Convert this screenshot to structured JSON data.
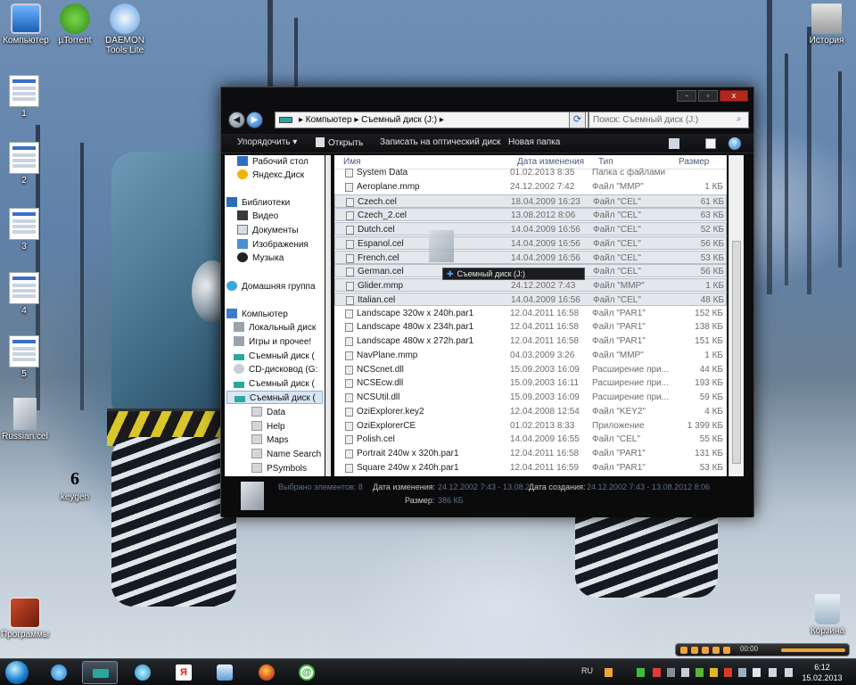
{
  "desktop": {
    "icons": [
      {
        "label": "Компьютер",
        "icon": "computer-icon"
      },
      {
        "label": "µTorrent",
        "icon": "utorrent-icon"
      },
      {
        "label": "DAEMON Tools Lite",
        "icon": "daemon-tools-icon"
      },
      {
        "label": "История",
        "icon": "history-icon"
      },
      {
        "label": "1",
        "icon": "window-thumbnail"
      },
      {
        "label": "2",
        "icon": "window-thumbnail"
      },
      {
        "label": "3",
        "icon": "window-thumbnail"
      },
      {
        "label": "4",
        "icon": "window-thumbnail"
      },
      {
        "label": "5",
        "icon": "window-thumbnail"
      },
      {
        "label": "Russian.cel",
        "icon": "file-icon"
      },
      {
        "label": "keygen",
        "icon": "keygen-icon"
      },
      {
        "label": "Программы",
        "icon": "programs-icon"
      },
      {
        "label": "Корзина",
        "icon": "recycle-bin-icon"
      }
    ],
    "keygen_glyph": "6"
  },
  "explorer": {
    "controls": {
      "minimize": "-",
      "maximize": "▫",
      "close": "x"
    },
    "address": {
      "path": "▸ Компьютер ▸ Съемный диск (J:) ▸",
      "dropdown": "▾"
    },
    "search_placeholder": "Поиск: Съемный диск (J:)",
    "toolbar": {
      "organize": "Упорядочить ▾",
      "open": "Открыть",
      "burn": "Записать на оптический диск",
      "new_folder": "Новая папка"
    },
    "nav": [
      {
        "label": "Рабочий стол",
        "icon": "desktop-icon"
      },
      {
        "label": "Яндекс.Диск",
        "icon": "yandex-disk-icon"
      },
      {
        "label": "Библиотеки",
        "icon": "libraries-icon"
      },
      {
        "label": "Видео",
        "icon": "video-icon"
      },
      {
        "label": "Документы",
        "icon": "documents-icon"
      },
      {
        "label": "Изображения",
        "icon": "pictures-icon"
      },
      {
        "label": "Музыка",
        "icon": "music-icon"
      },
      {
        "label": "Домашняя группа",
        "icon": "homegroup-icon"
      },
      {
        "label": "Компьютер",
        "icon": "computer-icon"
      },
      {
        "label": "Локальный диск",
        "icon": "drive-icon"
      },
      {
        "label": "Игры и прочее!",
        "icon": "drive-icon"
      },
      {
        "label": "Съемный диск (",
        "icon": "usb-drive-icon"
      },
      {
        "label": "CD-дисковод (G:",
        "icon": "cd-drive-icon"
      },
      {
        "label": "Съемный диск (",
        "icon": "usb-drive-icon"
      },
      {
        "label": "Съемный диск (",
        "icon": "usb-drive-icon"
      },
      {
        "label": "Data",
        "icon": "folder-icon"
      },
      {
        "label": "Help",
        "icon": "folder-icon"
      },
      {
        "label": "Maps",
        "icon": "folder-icon"
      },
      {
        "label": "Name Search",
        "icon": "folder-icon"
      },
      {
        "label": "PSymbols",
        "icon": "folder-icon"
      }
    ],
    "columns": [
      "Имя",
      "Дата изменения",
      "Тип",
      "Размер"
    ],
    "files": [
      {
        "name": "System Data",
        "date": "01.02.2013 8:35",
        "type": "Папка с файлами",
        "size": "",
        "selected": false
      },
      {
        "name": "Aeroplane.mmp",
        "date": "24.12.2002 7:42",
        "type": "Файл \"MMP\"",
        "size": "1 КБ",
        "selected": false
      },
      {
        "name": "Czech.cel",
        "date": "18.04.2009 16:23",
        "type": "Файл \"CEL\"",
        "size": "61 КБ",
        "selected": true
      },
      {
        "name": "Czech_2.cel",
        "date": "13.08.2012 8:06",
        "type": "Файл \"CEL\"",
        "size": "63 КБ",
        "selected": true
      },
      {
        "name": "Dutch.cel",
        "date": "14.04.2009 16:56",
        "type": "Файл \"CEL\"",
        "size": "52 КБ",
        "selected": true
      },
      {
        "name": "Espanol.cel",
        "date": "14.04.2009 16:56",
        "type": "Файл \"CEL\"",
        "size": "56 КБ",
        "selected": true
      },
      {
        "name": "French.cel",
        "date": "14.04.2009 16:56",
        "type": "Файл \"CEL\"",
        "size": "53 КБ",
        "selected": true
      },
      {
        "name": "German.cel",
        "date": "14.04.2009 16:56",
        "type": "Файл \"CEL\"",
        "size": "56 КБ",
        "selected": true
      },
      {
        "name": "Glider.mmp",
        "date": "24.12.2002 7:43",
        "type": "Файл \"MMP\"",
        "size": "1 КБ",
        "selected": true
      },
      {
        "name": "Italian.cel",
        "date": "14.04.2009 16:56",
        "type": "Файл \"CEL\"",
        "size": "48 КБ",
        "selected": true
      },
      {
        "name": "Landscape 320w x 240h.par1",
        "date": "12.04.2011 16:58",
        "type": "Файл \"PAR1\"",
        "size": "152 КБ",
        "selected": false
      },
      {
        "name": "Landscape 480w x 234h.par1",
        "date": "12.04.2011 16:58",
        "type": "Файл \"PAR1\"",
        "size": "138 КБ",
        "selected": false
      },
      {
        "name": "Landscape 480w x 272h.par1",
        "date": "12.04.2011 16:58",
        "type": "Файл \"PAR1\"",
        "size": "151 КБ",
        "selected": false
      },
      {
        "name": "NavPlane.mmp",
        "date": "04.03.2009 3:26",
        "type": "Файл \"MMP\"",
        "size": "1 КБ",
        "selected": false
      },
      {
        "name": "NCScnet.dll",
        "date": "15.09.2003 16:09",
        "type": "Расширение при...",
        "size": "44 КБ",
        "selected": false
      },
      {
        "name": "NCSEcw.dll",
        "date": "15.09.2003 16:11",
        "type": "Расширение при...",
        "size": "193 КБ",
        "selected": false
      },
      {
        "name": "NCSUtil.dll",
        "date": "15.09.2003 16:09",
        "type": "Расширение при...",
        "size": "59 КБ",
        "selected": false
      },
      {
        "name": "OziExplorer.key2",
        "date": "12.04.2008 12:54",
        "type": "Файл \"KEY2\"",
        "size": "4 КБ",
        "selected": false
      },
      {
        "name": "OziExplorerCE",
        "date": "01.02.2013 8:33",
        "type": "Приложение",
        "size": "1 399 КБ",
        "selected": false
      },
      {
        "name": "Polish.cel",
        "date": "14.04.2009 16:55",
        "type": "Файл \"CEL\"",
        "size": "55 КБ",
        "selected": false
      },
      {
        "name": "Portrait 240w x 320h.par1",
        "date": "12.04.2011 16:58",
        "type": "Файл \"PAR1\"",
        "size": "131 КБ",
        "selected": false
      },
      {
        "name": "Square 240w x 240h.par1",
        "date": "12.04.2011 16:59",
        "type": "Файл \"PAR1\"",
        "size": "53 КБ",
        "selected": false
      }
    ],
    "drag_tooltip": "Съемный диск (J:)",
    "details": {
      "selected_label": "Выбрано элементов: 8",
      "modified_label": "Дата изменения:",
      "modified_value": "24.12.2002 7:43 - 13.08.2...",
      "created_label": "Дата создания:",
      "created_value": "24.12.2002 7:43 - 13.08.2012 8:06",
      "size_label": "Размер:",
      "size_value": "386 КБ"
    }
  },
  "taskbar": {
    "language": "RU",
    "time": "6:12",
    "date": "15.02.2013",
    "pinned": [
      "start-orb",
      "ie-icon",
      "explorer-icon",
      "media-center-icon",
      "yandex-icon",
      "audio-icon",
      "firefox-icon",
      "icq-icon"
    ],
    "media_time": "00:00"
  },
  "colors": {
    "window_bg": "#0d0d0f",
    "selection": "#e4e7eb",
    "accent": "#2b77c9"
  }
}
